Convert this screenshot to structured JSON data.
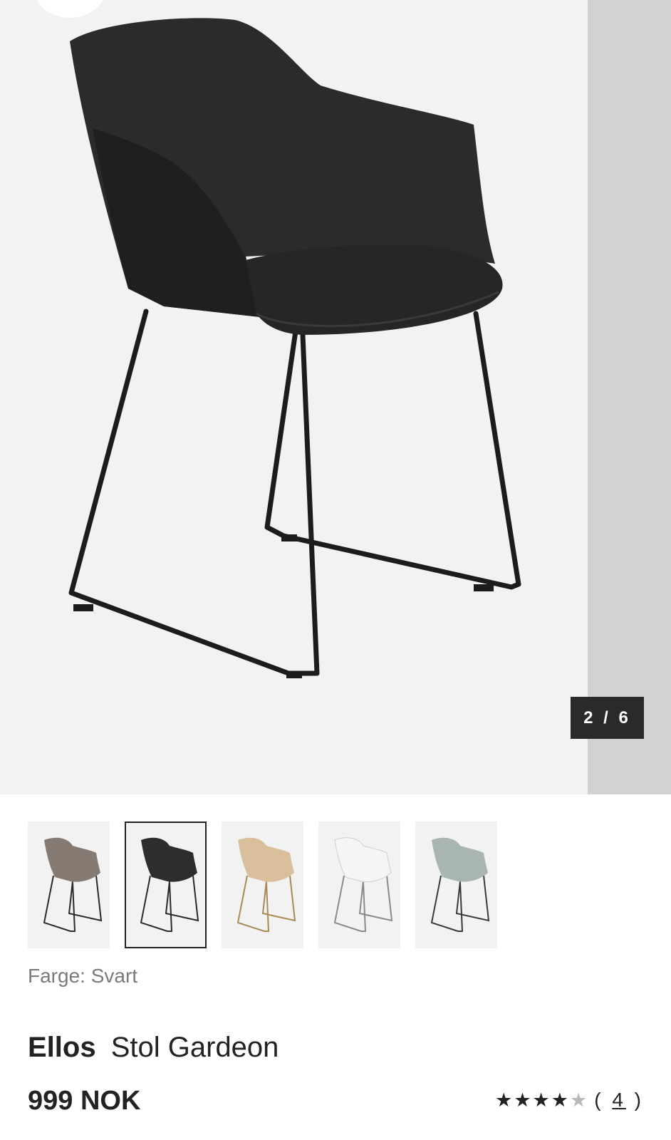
{
  "gallery": {
    "counter": "2 / 6",
    "current_image": 2,
    "total_images": 6
  },
  "colors": {
    "label": "Farge: Svart",
    "selected_index": 1,
    "options": [
      {
        "seat": "#857a72",
        "legs": "#2a2a2a"
      },
      {
        "seat": "#2d2d2d",
        "legs": "#2a2a2a"
      },
      {
        "seat": "#d9bf9c",
        "legs": "#a88a55"
      },
      {
        "seat": "#f5f5f5",
        "legs": "#8a8a8a"
      },
      {
        "seat": "#a9b6b0",
        "legs": "#3a3a3a"
      }
    ]
  },
  "product": {
    "brand": "Ellos",
    "name": "Stol Gardeon",
    "price": "999 NOK"
  },
  "rating": {
    "stars": 4,
    "max": 5,
    "count_open": "(",
    "count": "4",
    "count_close": ")"
  }
}
